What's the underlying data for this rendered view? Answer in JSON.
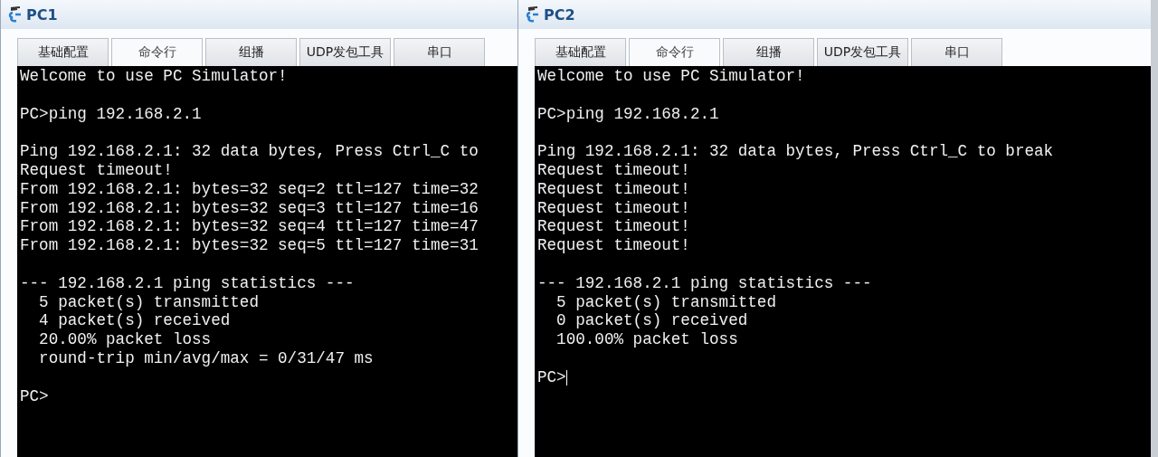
{
  "windows": [
    {
      "title": "PC1",
      "tabs": [
        {
          "label": "基础配置",
          "selected": false
        },
        {
          "label": "命令行",
          "selected": true
        },
        {
          "label": "组播",
          "selected": false
        },
        {
          "label": "UDP发包工具",
          "selected": false
        },
        {
          "label": "串口",
          "selected": false
        }
      ],
      "terminal": {
        "cursor": false,
        "blocks": [
          [
            "Welcome to use PC Simulator!"
          ],
          [
            "PC>ping 192.168.2.1"
          ],
          [
            "Ping 192.168.2.1: 32 data bytes, Press Ctrl_C to",
            "Request timeout!",
            "From 192.168.2.1: bytes=32 seq=2 ttl=127 time=32",
            "From 192.168.2.1: bytes=32 seq=3 ttl=127 time=16",
            "From 192.168.2.1: bytes=32 seq=4 ttl=127 time=47",
            "From 192.168.2.1: bytes=32 seq=5 ttl=127 time=31"
          ],
          [
            "--- 192.168.2.1 ping statistics ---",
            "  5 packet(s) transmitted",
            "  4 packet(s) received",
            "  20.00% packet loss",
            "  round-trip min/avg/max = 0/31/47 ms"
          ],
          [
            "PC>"
          ]
        ]
      }
    },
    {
      "title": "PC2",
      "tabs": [
        {
          "label": "基础配置",
          "selected": false
        },
        {
          "label": "命令行",
          "selected": true
        },
        {
          "label": "组播",
          "selected": false
        },
        {
          "label": "UDP发包工具",
          "selected": false
        },
        {
          "label": "串口",
          "selected": false
        }
      ],
      "terminal": {
        "cursor": true,
        "blocks": [
          [
            "Welcome to use PC Simulator!"
          ],
          [
            "PC>ping 192.168.2.1"
          ],
          [
            "Ping 192.168.2.1: 32 data bytes, Press Ctrl_C to break",
            "Request timeout!",
            "Request timeout!",
            "Request timeout!",
            "Request timeout!",
            "Request timeout!"
          ],
          [
            "--- 192.168.2.1 ping statistics ---",
            "  5 packet(s) transmitted",
            "  0 packet(s) received",
            "  100.00% packet loss"
          ],
          [
            "PC>"
          ]
        ]
      }
    }
  ]
}
